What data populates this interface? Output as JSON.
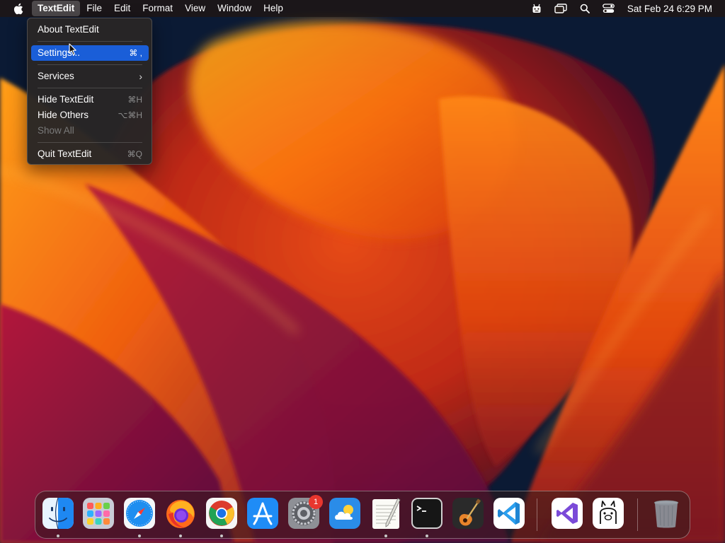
{
  "menubar": {
    "app_name": "TextEdit",
    "items": [
      "File",
      "Edit",
      "Format",
      "View",
      "Window",
      "Help"
    ],
    "clock": "Sat Feb 24  6:29 PM",
    "status_icons": [
      "automator-icon",
      "screen-mirroring-icon",
      "spotlight-search-icon",
      "control-center-icon"
    ]
  },
  "app_menu": {
    "items": [
      {
        "label": "About TextEdit",
        "shortcut": "",
        "state": "normal"
      },
      {
        "label": "Settings...",
        "shortcut": "⌘ ,",
        "state": "highlighted"
      },
      {
        "label": "Services",
        "shortcut": "",
        "submenu": true,
        "state": "normal"
      },
      {
        "label": "Hide TextEdit",
        "shortcut": "⌘H",
        "state": "normal"
      },
      {
        "label": "Hide Others",
        "shortcut": "⌥⌘H",
        "state": "normal"
      },
      {
        "label": "Show All",
        "shortcut": "",
        "state": "disabled"
      },
      {
        "label": "Quit TextEdit",
        "shortcut": "⌘Q",
        "state": "normal"
      }
    ]
  },
  "dock": {
    "apps": [
      {
        "name": "Finder",
        "icon": "finder-icon",
        "running": true
      },
      {
        "name": "Launchpad",
        "icon": "launchpad-icon",
        "running": false
      },
      {
        "name": "Safari",
        "icon": "safari-icon",
        "running": true
      },
      {
        "name": "Firefox",
        "icon": "firefox-icon",
        "running": true
      },
      {
        "name": "Google Chrome",
        "icon": "chrome-icon",
        "running": true
      },
      {
        "name": "App Store",
        "icon": "app-store-icon",
        "running": false
      },
      {
        "name": "System Settings",
        "icon": "system-settings-icon",
        "running": false,
        "badge": "1"
      },
      {
        "name": "Weather",
        "icon": "weather-icon",
        "running": false
      },
      {
        "name": "TextEdit",
        "icon": "textedit-icon",
        "running": true
      },
      {
        "name": "Terminal",
        "icon": "terminal-icon",
        "running": true
      },
      {
        "name": "GarageBand",
        "icon": "garageband-icon",
        "running": false
      },
      {
        "name": "Visual Studio Code",
        "icon": "vscode-icon",
        "running": false
      },
      {
        "name": "Visual Studio",
        "icon": "visual-studio-icon",
        "running": false
      },
      {
        "name": "Ollama",
        "icon": "ollama-icon",
        "running": false
      },
      {
        "name": "Trash",
        "icon": "trash-icon",
        "running": false
      }
    ]
  },
  "colors": {
    "highlight": "#1a5ed8",
    "badge": "#e8362e"
  }
}
